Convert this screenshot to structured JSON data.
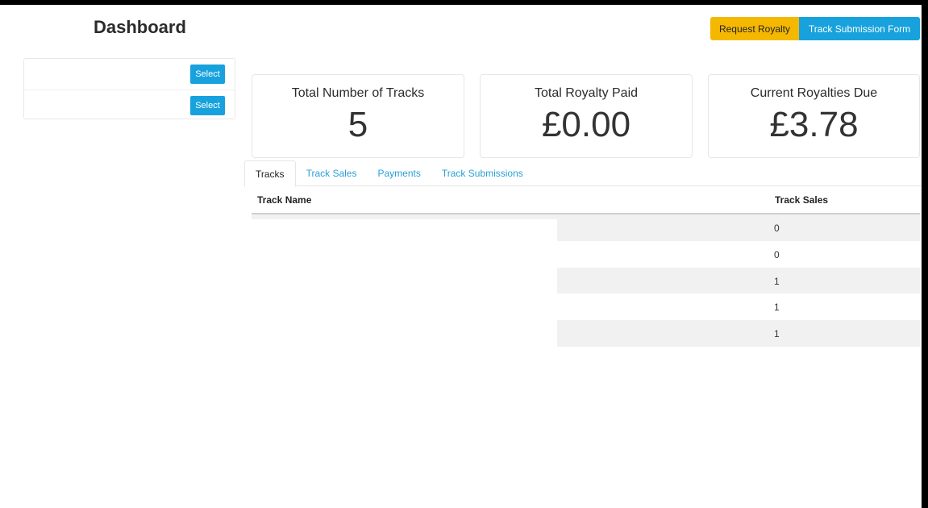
{
  "page": {
    "title": "Dashboard"
  },
  "header": {
    "request_royalty_label": "Request Royalty",
    "track_submission_label": "Track Submission Form"
  },
  "side_panel": {
    "items": [
      {
        "label": "",
        "button_label": "Select"
      },
      {
        "label": "",
        "button_label": "Select"
      }
    ]
  },
  "stats": [
    {
      "label": "Total Number of Tracks",
      "value": "5"
    },
    {
      "label": "Total Royalty Paid",
      "value": "£0.00"
    },
    {
      "label": "Current Royalties Due",
      "value": "£3.78"
    }
  ],
  "tabs": [
    {
      "label": "Tracks",
      "active": true
    },
    {
      "label": "Track Sales",
      "active": false
    },
    {
      "label": "Payments",
      "active": false
    },
    {
      "label": "Track Submissions",
      "active": false
    }
  ],
  "table": {
    "columns": [
      "Track Name",
      "Track Sales"
    ],
    "rows": [
      {
        "name": "",
        "sales": "0"
      },
      {
        "name": "",
        "sales": "0"
      },
      {
        "name": "",
        "sales": "1"
      },
      {
        "name": "",
        "sales": "1"
      },
      {
        "name": "",
        "sales": "1"
      }
    ]
  },
  "colors": {
    "primary": "#17a2dd",
    "warning": "#f5b800",
    "link": "#2a9fd6",
    "stripe": "#f1f1f1"
  }
}
